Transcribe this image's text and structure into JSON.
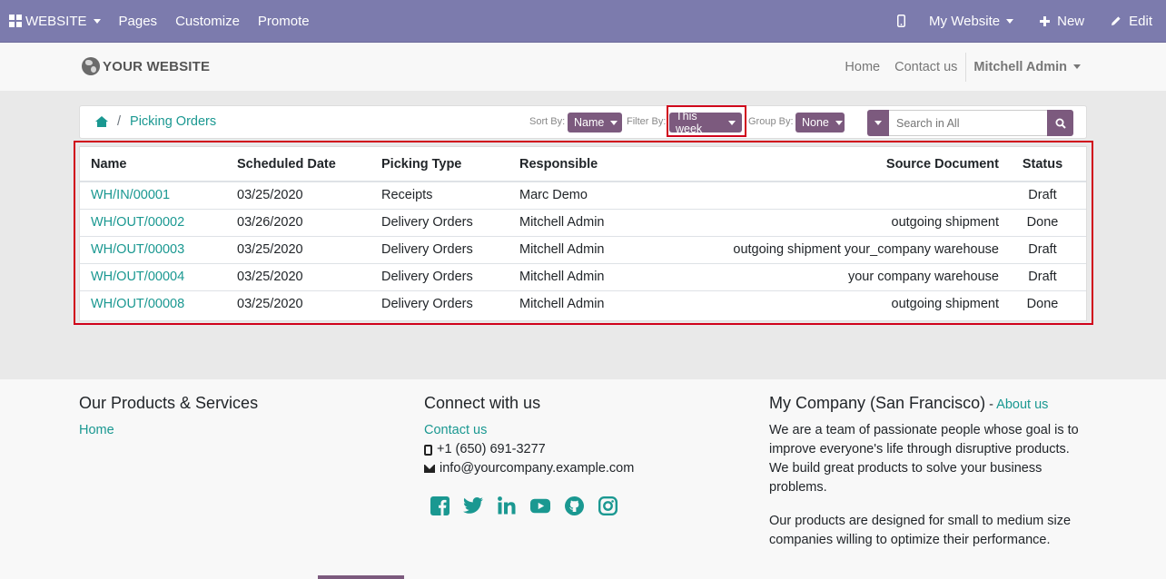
{
  "topbar": {
    "website": "WEBSITE",
    "pages": "Pages",
    "customize": "Customize",
    "promote": "Promote",
    "my_website": "My Website",
    "new": "New",
    "edit": "Edit"
  },
  "header": {
    "logo": "YOUR WEBSITE",
    "home": "Home",
    "contact": "Contact us",
    "user": "Mitchell Admin"
  },
  "controls": {
    "breadcrumb": "Picking Orders",
    "sort_label": "Sort By:",
    "sort_value": "Name",
    "filter_label": "Filter By:",
    "filter_value": "This week",
    "group_label": "Group By:",
    "group_value": "None",
    "search_placeholder": "Search in All"
  },
  "table": {
    "headers": [
      "Name",
      "Scheduled Date",
      "Picking Type",
      "Responsible",
      "Source Document",
      "Status"
    ],
    "rows": [
      {
        "name": "WH/IN/00001",
        "date": "03/25/2020",
        "type": "Receipts",
        "responsible": "Marc Demo",
        "source": "",
        "status": "Draft"
      },
      {
        "name": "WH/OUT/00002",
        "date": "03/26/2020",
        "type": "Delivery Orders",
        "responsible": "Mitchell Admin",
        "source": "outgoing shipment",
        "status": "Done"
      },
      {
        "name": "WH/OUT/00003",
        "date": "03/25/2020",
        "type": "Delivery Orders",
        "responsible": "Mitchell Admin",
        "source": "outgoing shipment your_company warehouse",
        "status": "Draft"
      },
      {
        "name": "WH/OUT/00004",
        "date": "03/25/2020",
        "type": "Delivery Orders",
        "responsible": "Mitchell Admin",
        "source": "your company warehouse",
        "status": "Draft"
      },
      {
        "name": "WH/OUT/00008",
        "date": "03/25/2020",
        "type": "Delivery Orders",
        "responsible": "Mitchell Admin",
        "source": "outgoing shipment",
        "status": "Done"
      }
    ]
  },
  "footer": {
    "products_title": "Our Products & Services",
    "products_home": "Home",
    "connect_title": "Connect with us",
    "connect_contact": "Contact us",
    "phone": "+1 (650) 691-3277",
    "email": "info@yourcompany.example.com",
    "company_title": "My Company (San Francisco)",
    "company_dash": " - ",
    "about": "About us",
    "para1": "We are a team of passionate people whose goal is to improve everyone's life through disruptive products. We build great products to solve your business problems.",
    "para2": "Our products are designed for small to medium size companies willing to optimize their performance.",
    "social_icons": [
      "facebook-icon",
      "twitter-icon",
      "linkedin-icon",
      "youtube-icon",
      "github-icon",
      "instagram-icon"
    ]
  },
  "colors": {
    "topbar": "#7c7bad",
    "accent": "#1a9891",
    "button": "#7c5a7e",
    "highlight": "#d0021b"
  }
}
